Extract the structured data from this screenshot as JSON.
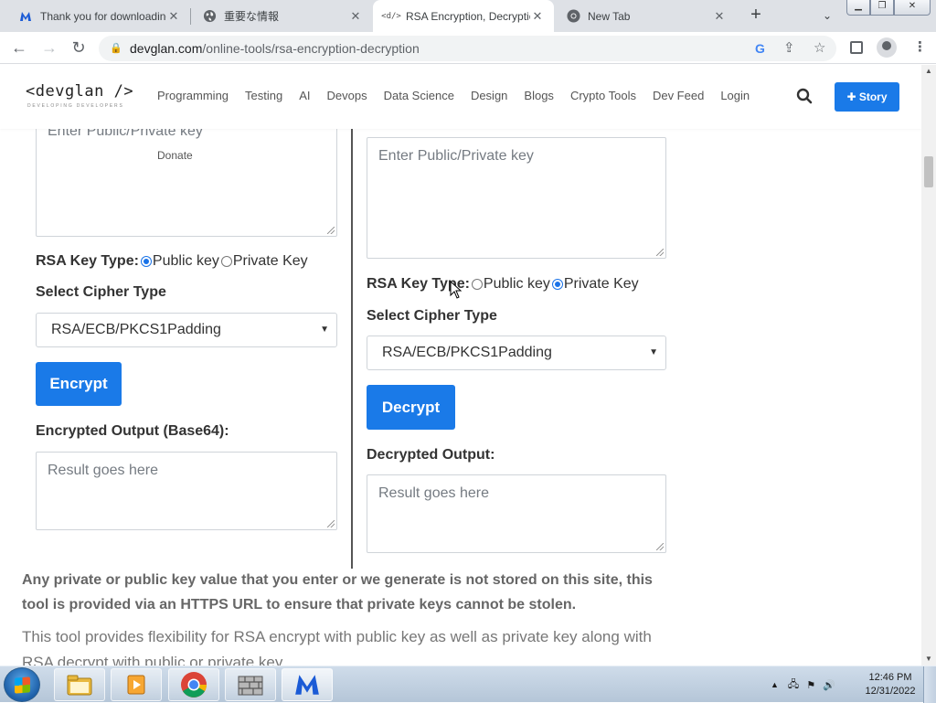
{
  "browser": {
    "tabs": [
      {
        "title": "Thank you for downloading",
        "favicon": "malwarebytes-m-icon"
      },
      {
        "title": "重要な情報",
        "favicon": "globe-icon"
      },
      {
        "title": "RSA Encryption, Decryption",
        "favicon": "devglan-code-icon"
      },
      {
        "title": "New Tab",
        "favicon": "chrome-icon"
      }
    ],
    "url_domain": "devglan.com",
    "url_path": "/online-tools/rsa-encryption-decryption"
  },
  "site": {
    "logo": "<devglan />",
    "logo_tagline": "DEVELOPING DEVELOPERS",
    "menu": [
      "Programming",
      "Testing",
      "AI",
      "Devops",
      "Data Science",
      "Design",
      "Blogs",
      "Crypto Tools",
      "Dev Feed",
      "Login"
    ],
    "story_button": "Story",
    "donate": "Donate"
  },
  "encrypt": {
    "key_placeholder": "Enter Public/Private key",
    "key_type_label": "RSA Key Type:",
    "option_public": "Public key",
    "option_private": "Private Key",
    "selected": "Public key",
    "cipher_label": "Select Cipher Type",
    "cipher_value": "RSA/ECB/PKCS1Padding",
    "button": "Encrypt",
    "output_label": "Encrypted Output (Base64):",
    "output_placeholder": "Result goes here"
  },
  "decrypt": {
    "key_placeholder": "Enter Public/Private key",
    "key_type_label": "RSA Key Type:",
    "option_public": "Public key",
    "option_private": "Private Key",
    "selected": "Private Key",
    "cipher_label": "Select Cipher Type",
    "cipher_value": "RSA/ECB/PKCS1Padding",
    "button": "Decrypt",
    "output_label": "Decrypted Output:",
    "output_placeholder": "Result goes here"
  },
  "notice": "Any private or public key value that you enter or we generate is not stored on this site, this tool is provided via an HTTPS URL to ensure that private keys cannot be stolen.",
  "description": "This tool provides flexibility for RSA encrypt with public key as well as private key along with RSA decrypt with public or private key.",
  "taskbar": {
    "time": "12:46 PM",
    "date": "12/31/2022",
    "apps": [
      "explorer-icon",
      "media-player-icon",
      "chrome-icon",
      "firewall-icon",
      "malwarebytes-icon"
    ]
  },
  "colors": {
    "accent": "#1a7ae8",
    "text": "#333333",
    "placeholder": "#757b82"
  }
}
